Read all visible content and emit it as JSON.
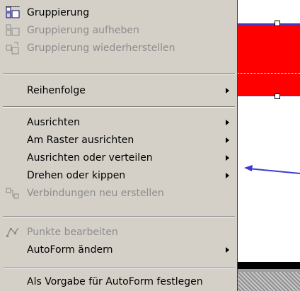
{
  "menu": {
    "items": [
      {
        "label": "Gruppierung",
        "enabled": true,
        "submenu": false,
        "icon": "group-icon"
      },
      {
        "label": "Gruppierung aufheben",
        "enabled": false,
        "submenu": false,
        "icon": "ungroup-icon"
      },
      {
        "label": "Gruppierung wiederherstellen",
        "enabled": false,
        "submenu": false,
        "icon": "regroup-icon"
      },
      {
        "label": "Reihenfolge",
        "enabled": true,
        "submenu": true
      },
      {
        "label": "Ausrichten",
        "enabled": true,
        "submenu": true
      },
      {
        "label": "Am Raster ausrichten",
        "enabled": true,
        "submenu": true
      },
      {
        "label": "Ausrichten oder verteilen",
        "enabled": true,
        "submenu": true
      },
      {
        "label": "Drehen oder kippen",
        "enabled": true,
        "submenu": true
      },
      {
        "label": "Verbindungen neu erstellen",
        "enabled": false,
        "submenu": false,
        "icon": "reroute-connectors-icon"
      },
      {
        "label": "Punkte bearbeiten",
        "enabled": false,
        "submenu": false,
        "icon": "edit-points-icon"
      },
      {
        "label": "AutoForm ändern",
        "enabled": true,
        "submenu": true
      },
      {
        "label": "Als Vorgabe für AutoForm festlegen",
        "enabled": true,
        "submenu": false
      }
    ]
  },
  "colors": {
    "menu_bg": "#d4d0c8",
    "disabled_text": "#8c8c8c",
    "shape_fill": "#ff0000",
    "shape_border": "#3b3bd1",
    "connector": "#3b3bd1"
  }
}
